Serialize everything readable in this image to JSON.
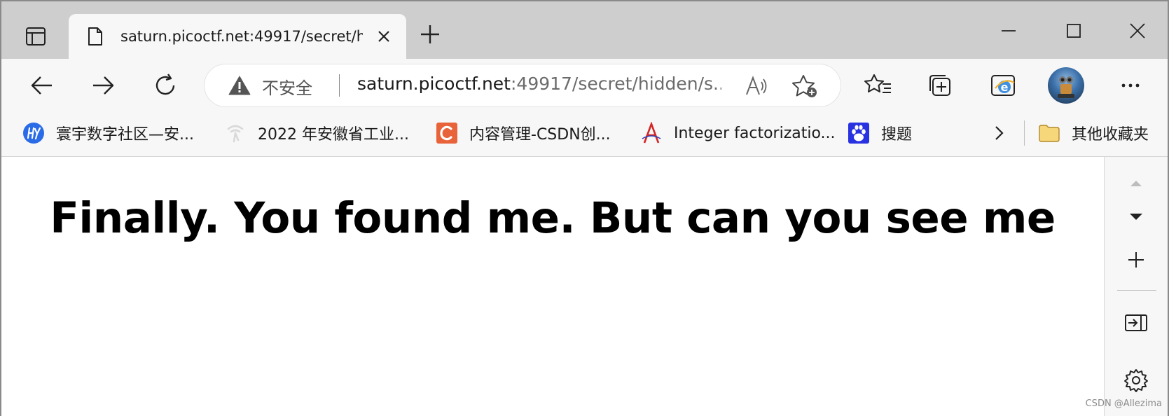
{
  "tab": {
    "title": "saturn.picoctf.net:49917/secret/hidden/s..."
  },
  "address_bar": {
    "security_label": "不安全",
    "url_host": "saturn.picoctf.net",
    "url_path": ":49917/secret/hidden/s..."
  },
  "favorites": [
    {
      "label": "寰宇数字社区—安...",
      "icon": "hy-logo-icon"
    },
    {
      "label": "2022 年安徽省工业...",
      "icon": "telecom-icon"
    },
    {
      "label": "内容管理-CSDN创...",
      "icon": "csdn-c-icon"
    },
    {
      "label": "Integer factorizatio...",
      "icon": "alpertron-a-icon"
    },
    {
      "label": "搜题",
      "icon": "baidu-paw-icon"
    }
  ],
  "other_favorites": "其他收藏夹",
  "page": {
    "headline": "Finally. You found me. But can you see me"
  },
  "watermark": "CSDN @Allezima",
  "colors": {
    "tabbar_bg": "#cecece",
    "toolbar_bg": "#f7f7f7",
    "csdn_orange": "#e8623a",
    "baidu_blue": "#2932e1",
    "hy_blue": "#2a6be8"
  }
}
